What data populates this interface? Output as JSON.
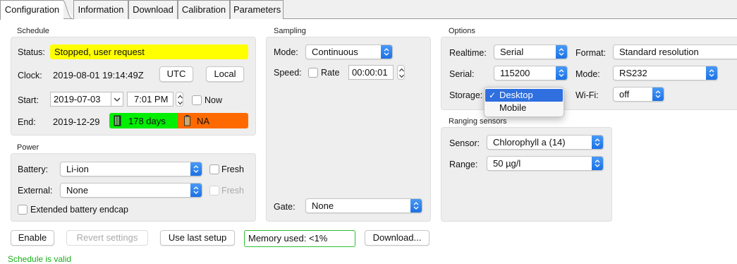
{
  "tabs": [
    "Configuration",
    "Information",
    "Download",
    "Calibration",
    "Parameters"
  ],
  "schedule": {
    "title": "Schedule",
    "status_label": "Status:",
    "status_value": "Stopped, user request",
    "status_color": "#ffff00",
    "clock_label": "Clock:",
    "clock_value": "2019-08-01 19:14:49Z",
    "utc_button": "UTC",
    "local_button": "Local",
    "start_label": "Start:",
    "start_date": "2019-07-03",
    "start_time": "7:01 PM",
    "now_label": "Now",
    "end_label": "End:",
    "end_date": "2019-12-29",
    "memory_duration": "178 days",
    "battery_duration": "NA",
    "memory_color": "#00ee00",
    "battery_color": "#ff6a00"
  },
  "power": {
    "title": "Power",
    "battery_label": "Battery:",
    "battery_value": "Li-ion",
    "fresh_label": "Fresh",
    "external_label": "External:",
    "external_value": "None",
    "fresh2_label": "Fresh",
    "endcap_label": "Extended battery endcap"
  },
  "sampling": {
    "title": "Sampling",
    "mode_label": "Mode:",
    "mode_value": "Continuous",
    "speed_label": "Speed:",
    "rate_label": "Rate",
    "rate_value": "00:00:01",
    "gate_label": "Gate:",
    "gate_value": "None"
  },
  "options": {
    "title": "Options",
    "realtime_label": "Realtime:",
    "realtime_value": "Serial",
    "format_label": "Format:",
    "format_value": "Standard resolution",
    "serial_label": "Serial:",
    "serial_value": "115200",
    "mode_label": "Mode:",
    "mode_value": "RS232",
    "storage_label": "Storage:",
    "wifi_label": "Wi-Fi:",
    "wifi_value": "off",
    "storage_menu": [
      {
        "label": "Desktop",
        "selected": true
      },
      {
        "label": "Mobile",
        "selected": false
      }
    ]
  },
  "ranging": {
    "title": "Ranging sensors",
    "sensor_label": "Sensor:",
    "sensor_value": "Chlorophyll a (14)",
    "range_label": "Range:",
    "range_value": "50 µg/l"
  },
  "bottom": {
    "enable_button": "Enable",
    "revert_button": "Revert settings",
    "last_setup_button": "Use last setup",
    "memory_used": "Memory used: <1%",
    "download_button": "Download...",
    "status_message": "Schedule is valid",
    "accent_color": "#2f6fe0"
  }
}
